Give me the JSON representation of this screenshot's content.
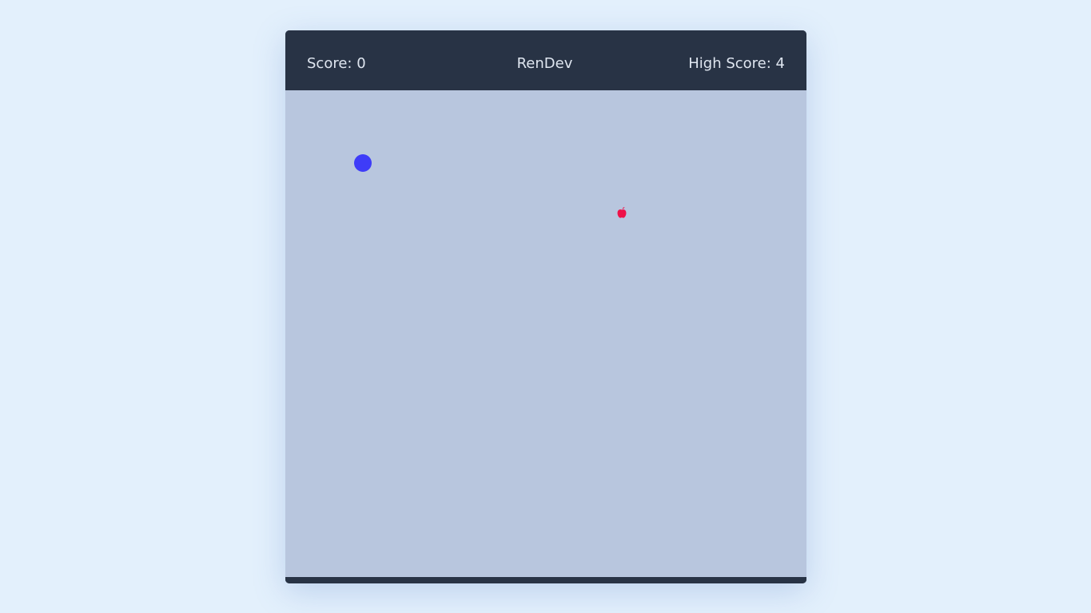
{
  "header": {
    "score_label": "Score: 0",
    "title": "RenDev",
    "high_score_label": "High Score: 4"
  },
  "board": {
    "background_color": "#b8c6de",
    "snake_color": "#3e3cf8",
    "food_icon": "apple-icon",
    "food_color": "#ee1148"
  },
  "theme": {
    "page_background": "#e3f0fc",
    "header_background": "#283345",
    "header_text_color": "#dfe6f0"
  }
}
